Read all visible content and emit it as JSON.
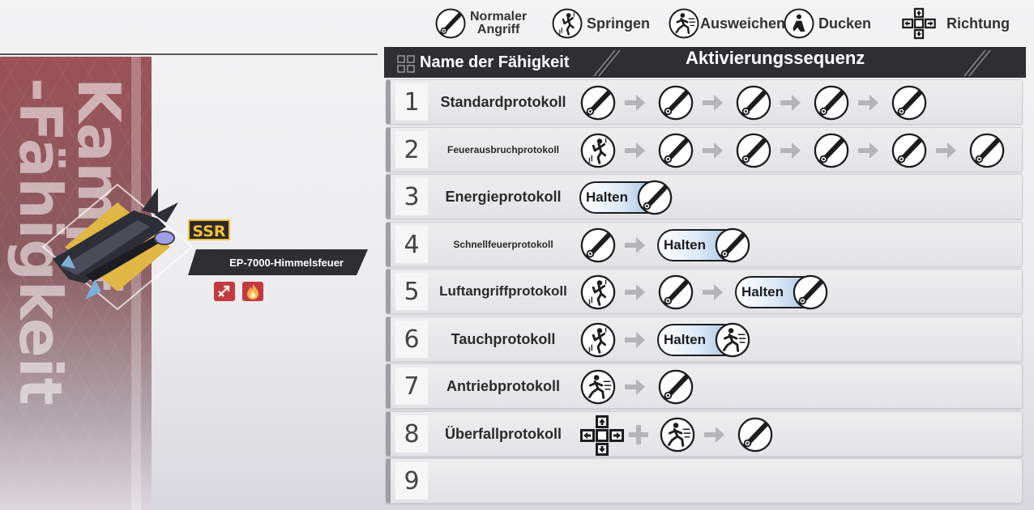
{
  "legend": [
    {
      "icon": "sword-icon",
      "label_line1": "Normaler",
      "label_line2": "Angriff"
    },
    {
      "icon": "jump-icon",
      "label": "Springen"
    },
    {
      "icon": "dodge-icon",
      "label": "Ausweichen"
    },
    {
      "icon": "crouch-icon",
      "label": "Ducken"
    },
    {
      "icon": "dpad-icon",
      "label": "Richtung"
    }
  ],
  "panel": {
    "title": "Kampf\n-Fähigkeit"
  },
  "weapon": {
    "rarity": "SSR",
    "name": "EP-7000-Himmelsfeuer",
    "badges": [
      "attack-type-icon",
      "fire-element-icon"
    ]
  },
  "table": {
    "col_name": "Name der Fähigkeit",
    "col_sequence": "Aktivierungssequenz",
    "hold_label": "Halten",
    "rows": [
      {
        "num": "1",
        "name": "Standardprotokoll",
        "sequence": [
          "attack",
          "attack",
          "attack",
          "attack",
          "attack"
        ]
      },
      {
        "num": "2",
        "name": "Feuerausbruchprotokoll",
        "sequence": [
          "jump",
          "attack",
          "attack",
          "attack",
          "attack",
          "attack"
        ]
      },
      {
        "num": "3",
        "name": "Energieprotokoll",
        "sequence": [
          "hold-attack"
        ]
      },
      {
        "num": "4",
        "name": "Schnellfeuerprotokoll",
        "sequence": [
          "attack",
          "hold-attack"
        ]
      },
      {
        "num": "5",
        "name": "Luftangriffprotokoll",
        "sequence": [
          "jump",
          "attack",
          "hold-attack"
        ]
      },
      {
        "num": "6",
        "name": "Tauchprotokoll",
        "sequence": [
          "jump",
          "hold-dodge"
        ]
      },
      {
        "num": "7",
        "name": "Antriebprotokoll",
        "sequence": [
          "dodge",
          "attack"
        ]
      },
      {
        "num": "8",
        "name": "Überfallprotokoll",
        "sequence": [
          "dpad",
          "plus",
          "dodge",
          "attack"
        ]
      },
      {
        "num": "9",
        "name": "",
        "sequence": []
      }
    ]
  },
  "colors": {
    "header_bg": "#2f2f33",
    "panel_red": "#9a5257",
    "ssr_gold": "#f2c13a",
    "hold_blue": "#8fb2d8"
  }
}
